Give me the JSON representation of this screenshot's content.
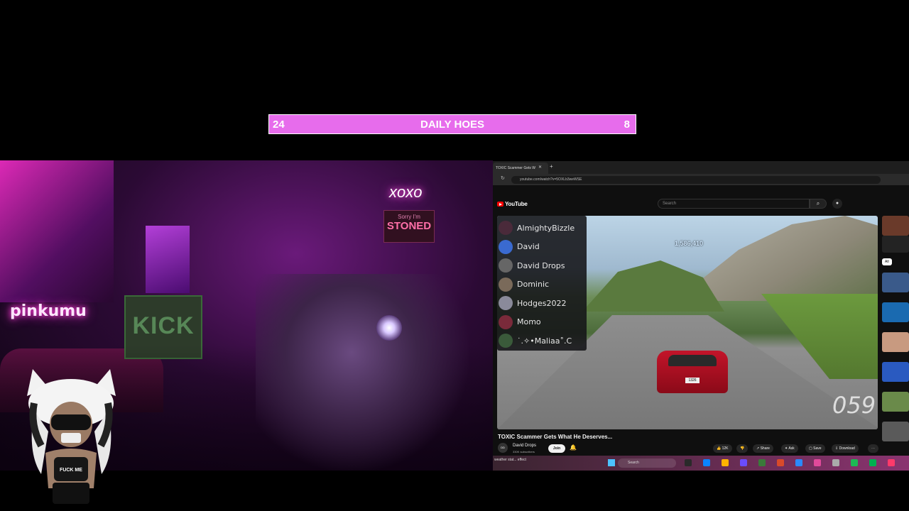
{
  "counter": {
    "left": "24",
    "title": "DAILY HOES",
    "right": "8",
    "background": "#e76cec"
  },
  "webcam": {
    "neon_left": "pinkumu",
    "neon_right": "xoxo",
    "sign_top": "Sorry I'm",
    "sign_bottom": "STONED",
    "art_text": "KICK"
  },
  "avatar": {
    "shirt_text": "FUCK ME"
  },
  "browser": {
    "tab_title": "TOXIC Scammer Gets W",
    "url": "youtube.com/watch?v=5OXLb3weWSE"
  },
  "youtube": {
    "logo": "YouTube",
    "search_placeholder": "Search",
    "video_counter": "1,586,410",
    "speed": "059",
    "plate": "1326",
    "title": "TOXIC Scammer Gets What He Deserves...",
    "channel": "David Drops",
    "subscribers": "330K subscribers",
    "join": "Join",
    "likes": "12K",
    "share": "Share",
    "ask": "Ask",
    "save": "Save",
    "download": "Download",
    "chip": "All"
  },
  "members": [
    {
      "name": "AlmightyBizzle",
      "color": "#4a2a3a"
    },
    {
      "name": "David",
      "color": "#3a6ad0"
    },
    {
      "name": "David Drops",
      "color": "#666666"
    },
    {
      "name": "Dominic",
      "color": "#7a6a5a"
    },
    {
      "name": "Hodges2022",
      "color": "#8a8a9a"
    },
    {
      "name": "Momo",
      "color": "#7a2a3a"
    },
    {
      "name": "˙.✧•Maliaa˚.C",
      "color": "#3a5a3a"
    }
  ],
  "taskbar": {
    "weather": "weather stat... effect",
    "search": "Search"
  }
}
